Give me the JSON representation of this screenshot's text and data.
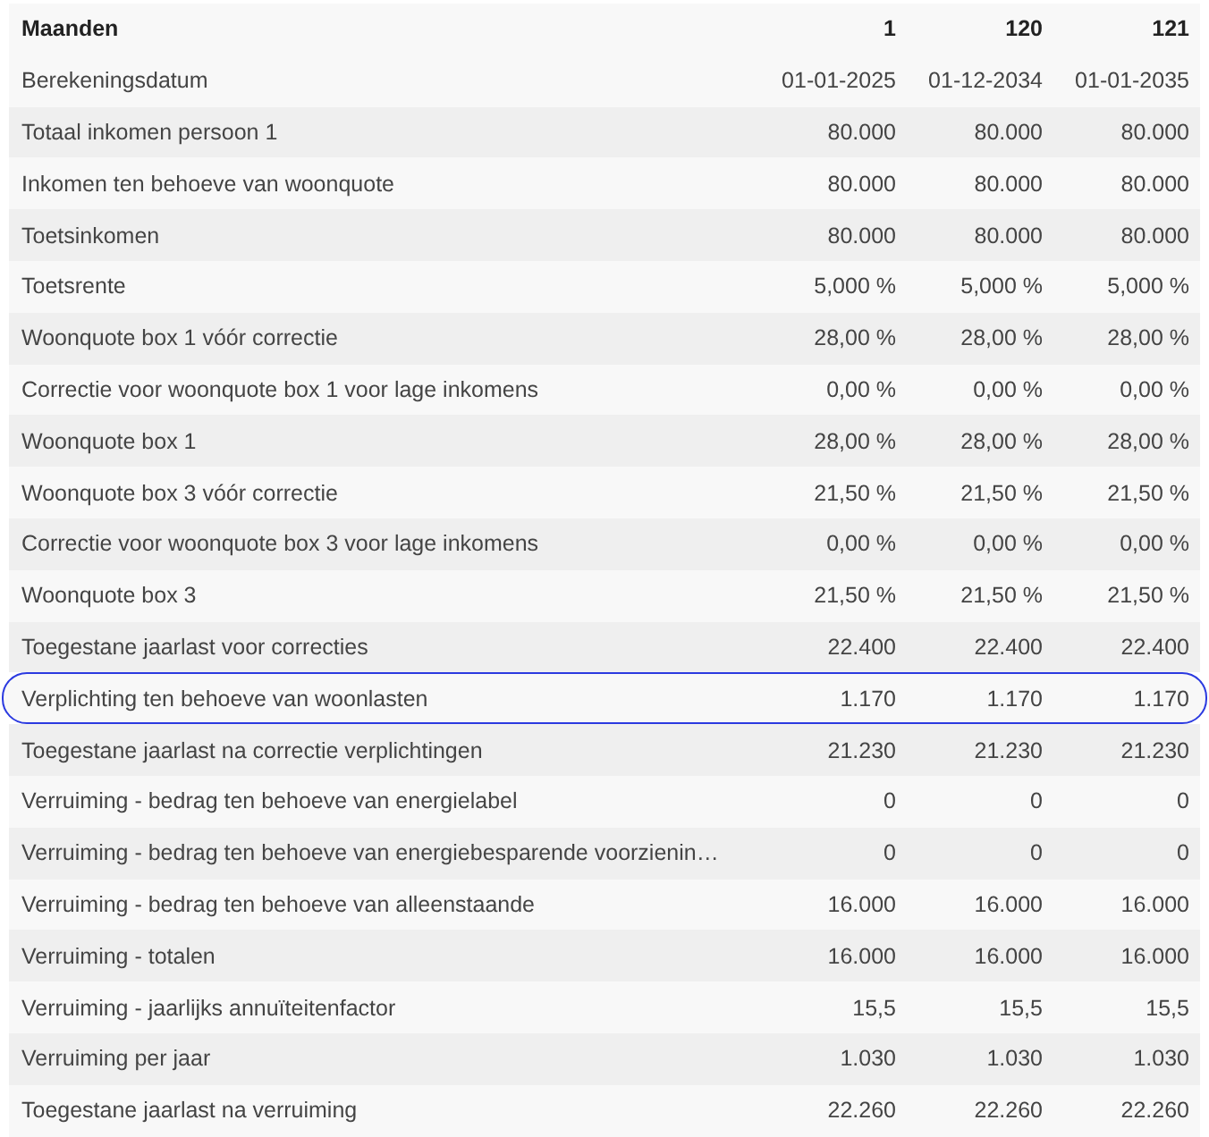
{
  "table": {
    "columns": [
      "Maanden",
      "1",
      "120",
      "121"
    ],
    "rows": [
      {
        "label": "Berekeningsdatum",
        "values": [
          "01-01-2025",
          "01-12-2034",
          "01-01-2035"
        ],
        "highlighted": false
      },
      {
        "label": "Totaal inkomen persoon 1",
        "values": [
          "80.000",
          "80.000",
          "80.000"
        ],
        "highlighted": false
      },
      {
        "label": "Inkomen ten behoeve van woonquote",
        "values": [
          "80.000",
          "80.000",
          "80.000"
        ],
        "highlighted": false
      },
      {
        "label": "Toetsinkomen",
        "values": [
          "80.000",
          "80.000",
          "80.000"
        ],
        "highlighted": false
      },
      {
        "label": "Toetsrente",
        "values": [
          "5,000 %",
          "5,000 %",
          "5,000 %"
        ],
        "highlighted": false
      },
      {
        "label": "Woonquote box 1 vóór correctie",
        "values": [
          "28,00 %",
          "28,00 %",
          "28,00 %"
        ],
        "highlighted": false
      },
      {
        "label": "Correctie voor woonquote box 1 voor lage inkomens",
        "values": [
          "0,00 %",
          "0,00 %",
          "0,00 %"
        ],
        "highlighted": false
      },
      {
        "label": "Woonquote box 1",
        "values": [
          "28,00 %",
          "28,00 %",
          "28,00 %"
        ],
        "highlighted": false
      },
      {
        "label": "Woonquote box 3 vóór correctie",
        "values": [
          "21,50 %",
          "21,50 %",
          "21,50 %"
        ],
        "highlighted": false
      },
      {
        "label": "Correctie voor woonquote box 3 voor lage inkomens",
        "values": [
          "0,00 %",
          "0,00 %",
          "0,00 %"
        ],
        "highlighted": false
      },
      {
        "label": "Woonquote box 3",
        "values": [
          "21,50 %",
          "21,50 %",
          "21,50 %"
        ],
        "highlighted": false
      },
      {
        "label": "Toegestane jaarlast voor correcties",
        "values": [
          "22.400",
          "22.400",
          "22.400"
        ],
        "highlighted": false
      },
      {
        "label": "Verplichting ten behoeve van woonlasten",
        "values": [
          "1.170",
          "1.170",
          "1.170"
        ],
        "highlighted": true
      },
      {
        "label": "Toegestane jaarlast na correctie verplichtingen",
        "values": [
          "21.230",
          "21.230",
          "21.230"
        ],
        "highlighted": false
      },
      {
        "label": "Verruiming - bedrag ten behoeve van energielabel",
        "values": [
          "0",
          "0",
          "0"
        ],
        "highlighted": false
      },
      {
        "label": "Verruiming - bedrag ten behoeve van energiebesparende voorzienin…",
        "values": [
          "0",
          "0",
          "0"
        ],
        "highlighted": false
      },
      {
        "label": "Verruiming - bedrag ten behoeve van alleenstaande",
        "values": [
          "16.000",
          "16.000",
          "16.000"
        ],
        "highlighted": false
      },
      {
        "label": "Verruiming - totalen",
        "values": [
          "16.000",
          "16.000",
          "16.000"
        ],
        "highlighted": false
      },
      {
        "label": "Verruiming - jaarlijks annuïteitenfactor",
        "values": [
          "15,5",
          "15,5",
          "15,5"
        ],
        "highlighted": false
      },
      {
        "label": "Verruiming per jaar",
        "values": [
          "1.030",
          "1.030",
          "1.030"
        ],
        "highlighted": false
      },
      {
        "label": "Toegestane jaarlast na verruiming",
        "values": [
          "22.260",
          "22.260",
          "22.260"
        ],
        "highlighted": false
      }
    ]
  }
}
